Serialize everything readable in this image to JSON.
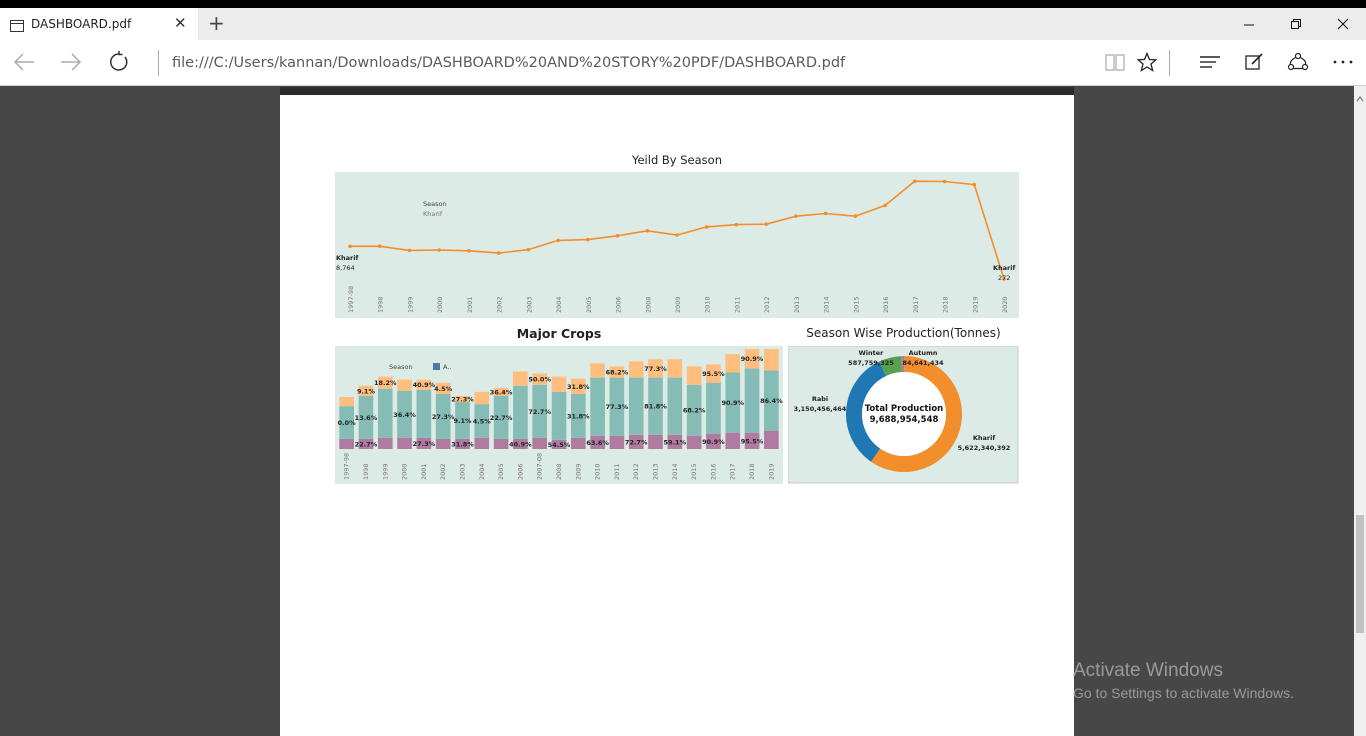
{
  "browser": {
    "tab_title": "DASHBOARD.pdf",
    "url": "file:///C:/Users/kannan/Downloads/DASHBOARD%20AND%20STORY%20PDF/DASHBOARD.pdf",
    "new_tab": "+",
    "close_tab": "✕"
  },
  "watermark": {
    "line1": "Activate Windows",
    "line2": "Go to Settings to activate Windows."
  },
  "colors": {
    "chart_bg": "#ddebe7",
    "line": "#f28e2b",
    "bar_top": "#ffbe7d",
    "bar_mid": "#86bcb6",
    "bar_bottom": "#b07aa1",
    "donut_kharif": "#f28e2b",
    "donut_rabi": "#1f77b4",
    "donut_winter": "#59a14f",
    "donut_autumn": "#b07aa1"
  },
  "chart_data": [
    {
      "type": "line",
      "title": "Yeild By Season",
      "legend_title": "Season",
      "legend_item": "Kharif",
      "x": [
        "1997-98",
        "1998",
        "1999",
        "2000",
        "2001",
        "2002",
        "2003",
        "2004",
        "2005",
        "2006",
        "2008",
        "2009",
        "2010",
        "2011",
        "2012",
        "2013",
        "2014",
        "2015",
        "2016",
        "2017",
        "2018",
        "2019",
        "2020"
      ],
      "values": [
        8764,
        8800,
        7700,
        7800,
        7600,
        7000,
        7900,
        10300,
        10500,
        11500,
        12800,
        11700,
        13800,
        14400,
        14500,
        16600,
        17300,
        16600,
        19400,
        25700,
        25600,
        24800,
        272
      ],
      "start_label": {
        "series": "Kharif",
        "value": "8,764"
      },
      "end_label": {
        "series": "Kharif",
        "value": "272"
      }
    },
    {
      "type": "bar",
      "title": "Major Crops",
      "legend_title": "Season",
      "legend_item": "A..",
      "categories": [
        "1997-98",
        "1998",
        "1999",
        "2000",
        "2001",
        "2002",
        "2003",
        "2004",
        "2005",
        "2006",
        "2007-08",
        "2008",
        "2009",
        "2010",
        "2011",
        "2012",
        "2013",
        "2014",
        "2015",
        "2016",
        "2017",
        "2018",
        "2019"
      ],
      "series": [
        {
          "key": "bottom",
          "values": [
            10,
            10,
            11,
            11,
            11,
            10,
            10,
            11,
            10,
            10,
            11,
            9,
            11,
            13,
            13,
            14,
            14,
            14,
            13,
            15,
            16,
            16,
            18
          ]
        },
        {
          "key": "mid",
          "values": [
            32,
            42,
            48,
            46,
            47,
            44,
            36,
            33,
            42,
            52,
            52,
            47,
            43,
            57,
            57,
            56,
            56,
            56,
            50,
            50,
            59,
            63,
            59
          ]
        },
        {
          "key": "top",
          "values": [
            9,
            10,
            12,
            11,
            10,
            11,
            6,
            12,
            8,
            14,
            11,
            15,
            15,
            14,
            11,
            16,
            18,
            18,
            18,
            18,
            18,
            19,
            21
          ]
        }
      ],
      "labels": [
        {
          "i": 0,
          "seg": "mid",
          "text": "0.0%"
        },
        {
          "i": 1,
          "seg": "top",
          "text": "9.1%"
        },
        {
          "i": 1,
          "seg": "mid",
          "text": "13.6%"
        },
        {
          "i": 1,
          "seg": "bottom",
          "text": "22.7%"
        },
        {
          "i": 2,
          "seg": "top",
          "text": "18.2%"
        },
        {
          "i": 3,
          "seg": "mid",
          "text": "36.4%"
        },
        {
          "i": 4,
          "seg": "top",
          "text": "40.9%"
        },
        {
          "i": 4,
          "seg": "bottom",
          "text": "27.3%"
        },
        {
          "i": 5,
          "seg": "top",
          "text": "4.5%"
        },
        {
          "i": 5,
          "seg": "mid",
          "text": "27.3%"
        },
        {
          "i": 6,
          "seg": "top",
          "text": "27.3%"
        },
        {
          "i": 6,
          "seg": "mid",
          "text": "9.1%"
        },
        {
          "i": 6,
          "seg": "bottom",
          "text": "31.8%"
        },
        {
          "i": 7,
          "seg": "mid",
          "text": "4.5%"
        },
        {
          "i": 8,
          "seg": "top",
          "text": "36.4%"
        },
        {
          "i": 8,
          "seg": "mid",
          "text": "22.7%"
        },
        {
          "i": 9,
          "seg": "bottom",
          "text": "40.9%"
        },
        {
          "i": 10,
          "seg": "top",
          "text": "50.0%"
        },
        {
          "i": 10,
          "seg": "mid",
          "text": "72.7%"
        },
        {
          "i": 11,
          "seg": "bottom",
          "text": "54.5%"
        },
        {
          "i": 12,
          "seg": "top",
          "text": "31.8%"
        },
        {
          "i": 12,
          "seg": "mid",
          "text": "31.8%"
        },
        {
          "i": 13,
          "seg": "bottom",
          "text": "63.6%"
        },
        {
          "i": 14,
          "seg": "top",
          "text": "68.2%"
        },
        {
          "i": 14,
          "seg": "mid",
          "text": "77.3%"
        },
        {
          "i": 15,
          "seg": "bottom",
          "text": "72.7%"
        },
        {
          "i": 16,
          "seg": "top",
          "text": "77.3%"
        },
        {
          "i": 16,
          "seg": "mid",
          "text": "81.8%"
        },
        {
          "i": 17,
          "seg": "bottom",
          "text": "59.1%"
        },
        {
          "i": 18,
          "seg": "mid",
          "text": "68.2%"
        },
        {
          "i": 19,
          "seg": "top",
          "text": "95.5%"
        },
        {
          "i": 19,
          "seg": "bottom",
          "text": "90.9%"
        },
        {
          "i": 20,
          "seg": "mid",
          "text": "90.9%"
        },
        {
          "i": 21,
          "seg": "top",
          "text": "90.9%"
        },
        {
          "i": 21,
          "seg": "bottom",
          "text": "95.5%"
        },
        {
          "i": 22,
          "seg": "mid",
          "text": "86.4%"
        }
      ]
    },
    {
      "type": "pie",
      "title": "Season Wise Production(Tonnes)",
      "center_label": "Total Production",
      "center_value": "9,688,954,548",
      "slices": [
        {
          "name": "Kharif",
          "value": 5622340392,
          "label": "5,622,340,392"
        },
        {
          "name": "Rabi",
          "value": 3150456464,
          "label": "3,150,456,464"
        },
        {
          "name": "Winter",
          "value": 587759325,
          "label": "587,759,325"
        },
        {
          "name": "Autumn",
          "value": 84641434,
          "label": "84,641,434"
        }
      ]
    }
  ]
}
